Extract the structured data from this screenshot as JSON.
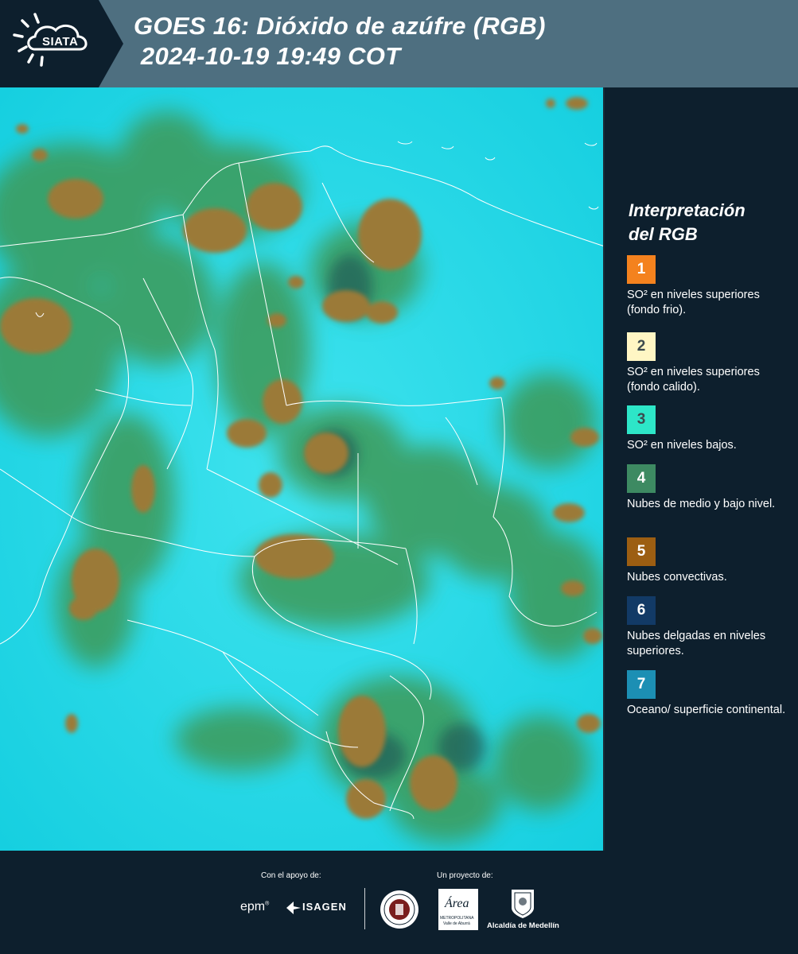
{
  "header": {
    "logo_text": "SIATA",
    "title_line1": "GOES 16: Dióxido de azúfre (RGB)",
    "title_line2": " 2024-10-19 19:49 COT"
  },
  "legend": {
    "title_line1": "Interpretación",
    "title_line2": "del RGB",
    "items": [
      {
        "number": "1",
        "label": "SO² en niveles superiores (fondo frio).",
        "color": "#f4821e"
      },
      {
        "number": "2",
        "label": "SO² en niveles superiores (fondo calido).",
        "color": "#fff6c4"
      },
      {
        "number": "3",
        "label": "SO² en niveles bajos.",
        "color": "#2de6c8"
      },
      {
        "number": "4",
        "label": "Nubes de medio y bajo nivel.",
        "color": "#3d8a62"
      },
      {
        "number": "5",
        "label": "Nubes convectivas.",
        "color": "#9c5e12"
      },
      {
        "number": "6",
        "label": "Nubes delgadas en niveles superiores.",
        "color": "#123a66"
      },
      {
        "number": "7",
        "label": "Oceano/ superficie continental.",
        "color": "#1c8fb4"
      }
    ]
  },
  "footer": {
    "support_label": "Con el apoyo de:",
    "project_label": "Un proyecto de:",
    "sponsor_epm": "epm",
    "sponsor_isagen": "ISAGEN",
    "sponsor_area_name": "Área",
    "sponsor_area_sub1": "METROPOLITANA",
    "sponsor_area_sub2": "Valle de Aburrá",
    "sponsor_alcaldia": "Alcaldía de Medellín"
  },
  "colors": {
    "header_bg": "#4e6f80",
    "panel_bg": "#0d1f2d",
    "map_cyan": "#21dbe8",
    "map_green": "#3f9a55",
    "map_brown": "#9c7a38",
    "borders": "#ffffff"
  }
}
